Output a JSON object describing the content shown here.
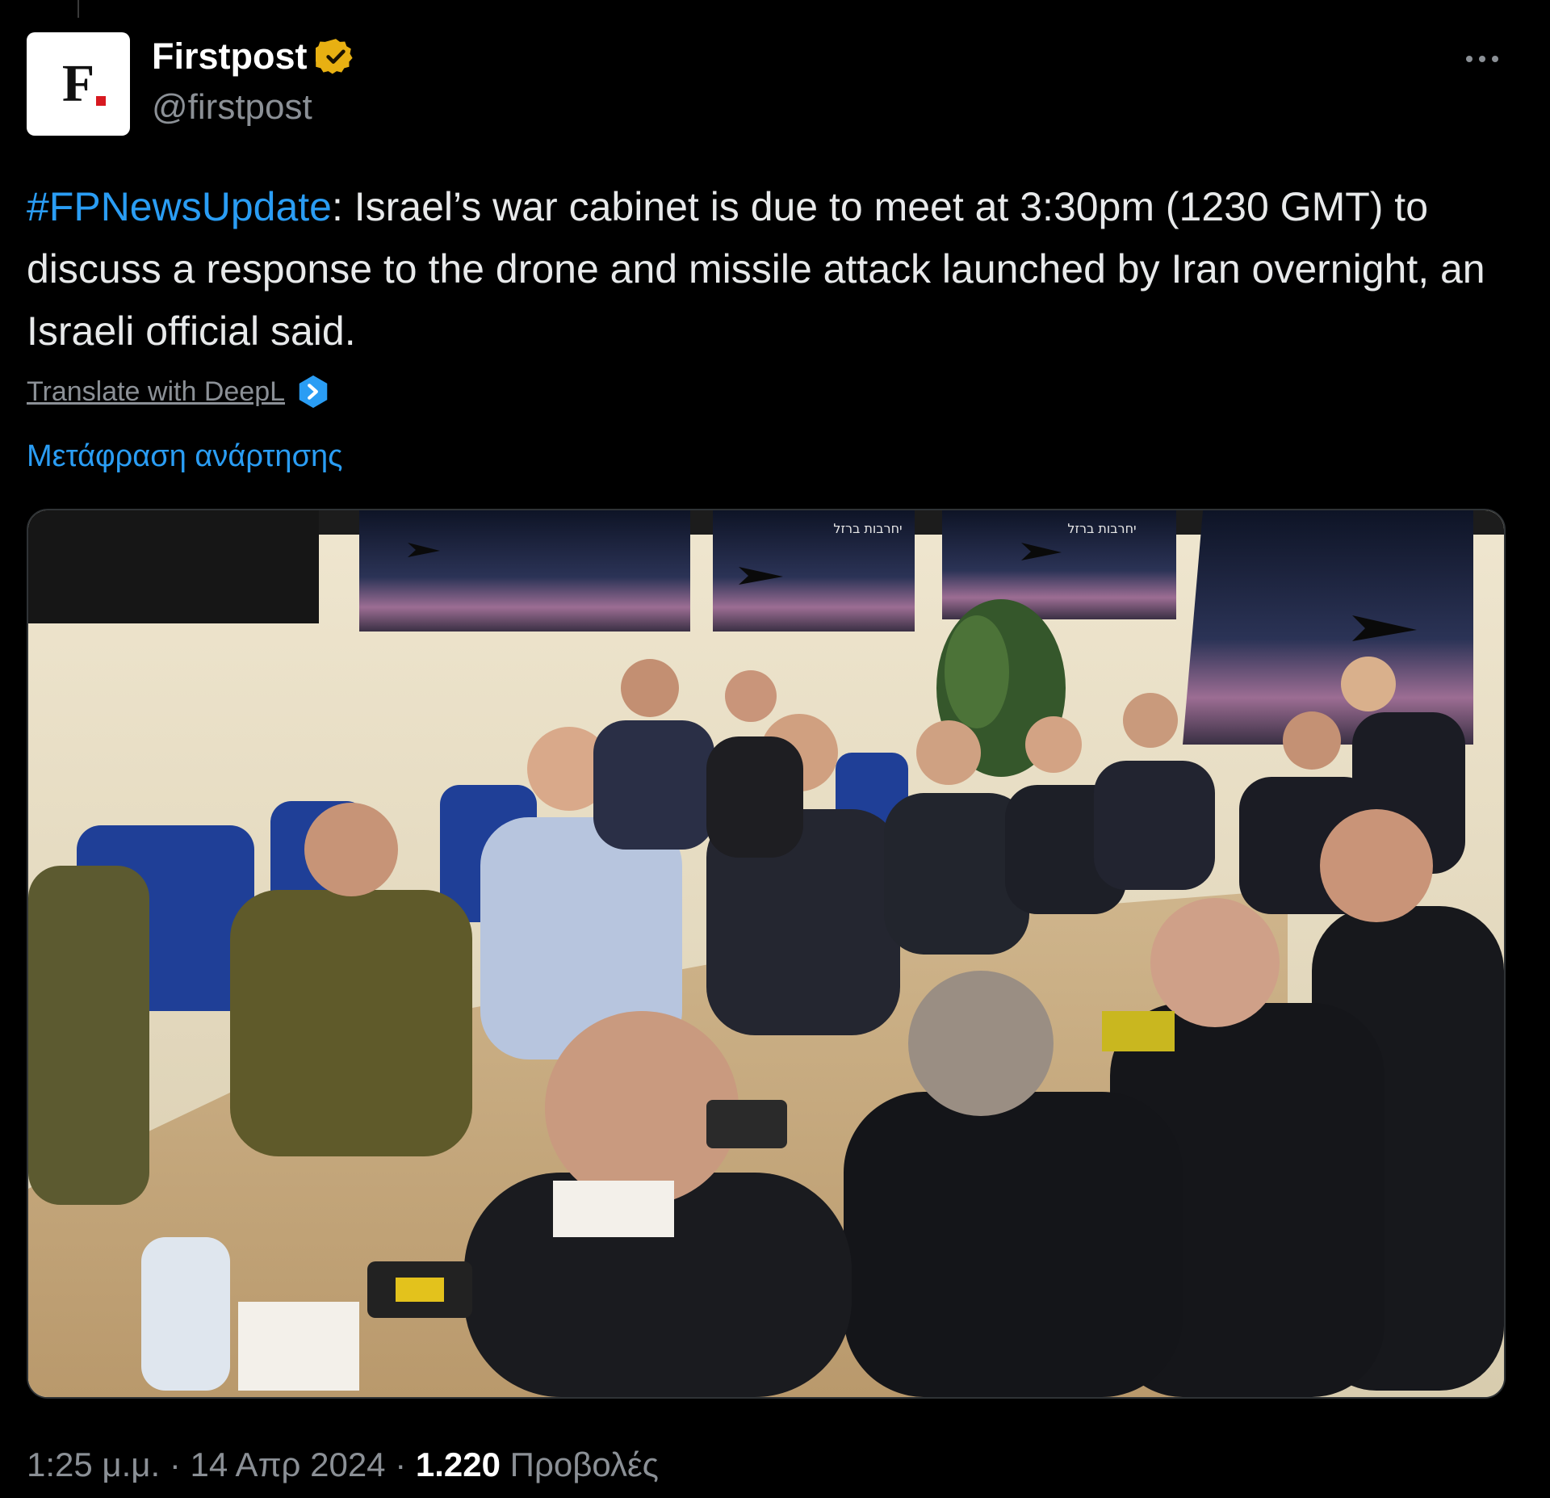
{
  "account": {
    "avatar_letter": "F",
    "display_name": "Firstpost",
    "handle": "@firstpost",
    "verified": "verified-gold-badge",
    "brand_color": "#d71920"
  },
  "tweet": {
    "hashtag": "#FPNewsUpdate",
    "body": ": Israel’s war cabinet is due to meet at 3:30pm (1230 GMT) to discuss a response to the drone and missile attack launched by Iran overnight, an Israeli official said."
  },
  "actions": {
    "translate_deepl": "Translate with DeepL",
    "translate_post": "Μετάφραση ανάρτησης",
    "more": "more-options-icon"
  },
  "media": {
    "screen_caption": "יחרבות ברזל"
  },
  "footer": {
    "time": "1:25 μ.μ.",
    "sep1": " · ",
    "date": "14 Απρ 2024",
    "sep2": " · ",
    "views": "1.220",
    "views_label": " Προβολές"
  },
  "colors": {
    "background": "#000000",
    "text": "#e7e9ea",
    "secondary": "#8b9096",
    "link": "#2a9df4",
    "verified": "#e8b012"
  }
}
